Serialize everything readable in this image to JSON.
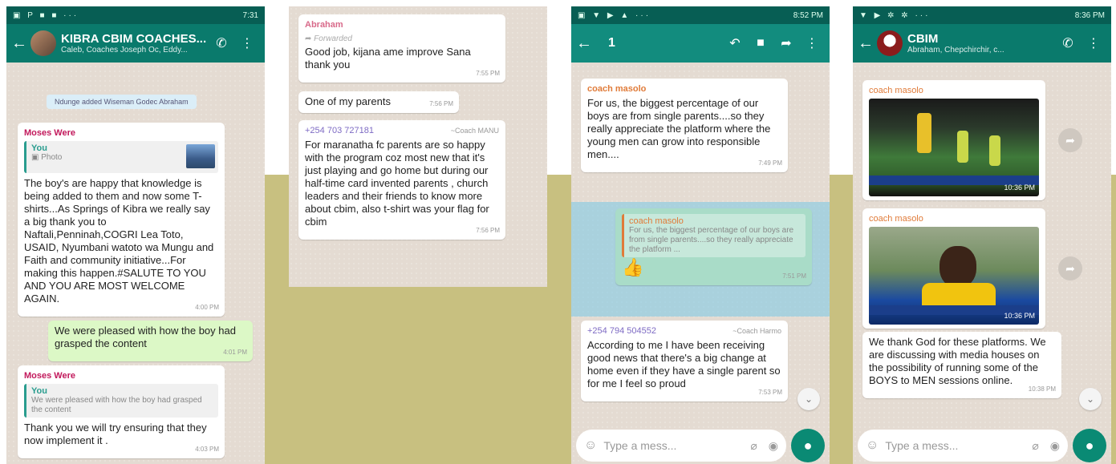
{
  "panel1": {
    "status_time": "7:31",
    "status_icons": "▣ P ■ ■ ···",
    "chat_title": "KIBRA CBIM COACHES...",
    "chat_subtitle": "Caleb, Coaches Joseph Oc, Eddy...",
    "system_message": "Ndunge added Wiseman Godec Abraham",
    "msg1": {
      "sender": "Moses Were",
      "quote_name": "You",
      "quote_text": "Photo",
      "text": "The boy's are happy that knowledge is being added to them and now some T-shirts...As Springs of Kibra we really say a big thank you to Naftali,Penninah,COGRI Lea Toto, USAID, Nyumbani watoto wa Mungu and Faith and community initiative...For making this happen.#SALUTE TO YOU AND YOU ARE MOST WELCOME AGAIN.",
      "time": "4:00 PM"
    },
    "msg2": {
      "text": "We were pleased with how the boy had grasped the content",
      "time": "4:01 PM"
    },
    "msg3": {
      "sender": "Moses Were",
      "quote_name": "You",
      "quote_text": "We were pleased with how the boy had grasped the content",
      "text": "Thank you we will try ensuring that they now implement it .",
      "time": "4:03 PM"
    }
  },
  "panel2": {
    "msg1": {
      "sender": "Abraham",
      "forwarded": "Forwarded",
      "text": "Good job, kijana ame improve Sana thank you",
      "time": "7:55 PM"
    },
    "msg2": {
      "text": "One of my parents",
      "time": "7:56 PM"
    },
    "msg3": {
      "sender": "+254 703 727181",
      "alias": "~Coach MANU",
      "text": "For maranatha fc parents are so happy with the program coz most new that it's just playing and go home but during our half-time card invented parents , church leaders and their friends to know more about cbim, also t-shirt was your flag for cbim",
      "time": "7:56 PM"
    }
  },
  "panel3": {
    "status_time": "8:52 PM",
    "selected_count": "1",
    "msg1": {
      "sender": "coach masolo",
      "text": "For us, the biggest percentage of our boys are from single parents....so they really appreciate the platform where the young men can grow into responsible men....",
      "time": "7:49 PM"
    },
    "msg2": {
      "quote_name": "coach masolo",
      "quote_text": "For us, the biggest percentage of our boys are from single parents....so they really appreciate the platform ...",
      "emoji": "👍",
      "time": "7:51 PM"
    },
    "msg3": {
      "sender": "+254 794 504552",
      "alias": "~Coach Harmo",
      "text": "According to me I have been receiving good news that there's a big change at home even if they have a single parent so for me I feel so proud",
      "time": "7:53 PM"
    },
    "input_placeholder": "Type a mess..."
  },
  "panel4": {
    "status_time": "8:36 PM",
    "chat_title": "CBIM",
    "chat_subtitle": "Abraham, Chepchirchir, c...",
    "msg1": {
      "sender": "coach masolo",
      "time": "10:36 PM"
    },
    "msg2": {
      "sender": "coach masolo",
      "time": "10:36 PM"
    },
    "msg3": {
      "text": "We thank God for these platforms. We are discussing with media houses on the possibility of running some of the BOYS to MEN sessions online.",
      "time": "10:38 PM"
    },
    "input_placeholder": "Type a mess..."
  }
}
